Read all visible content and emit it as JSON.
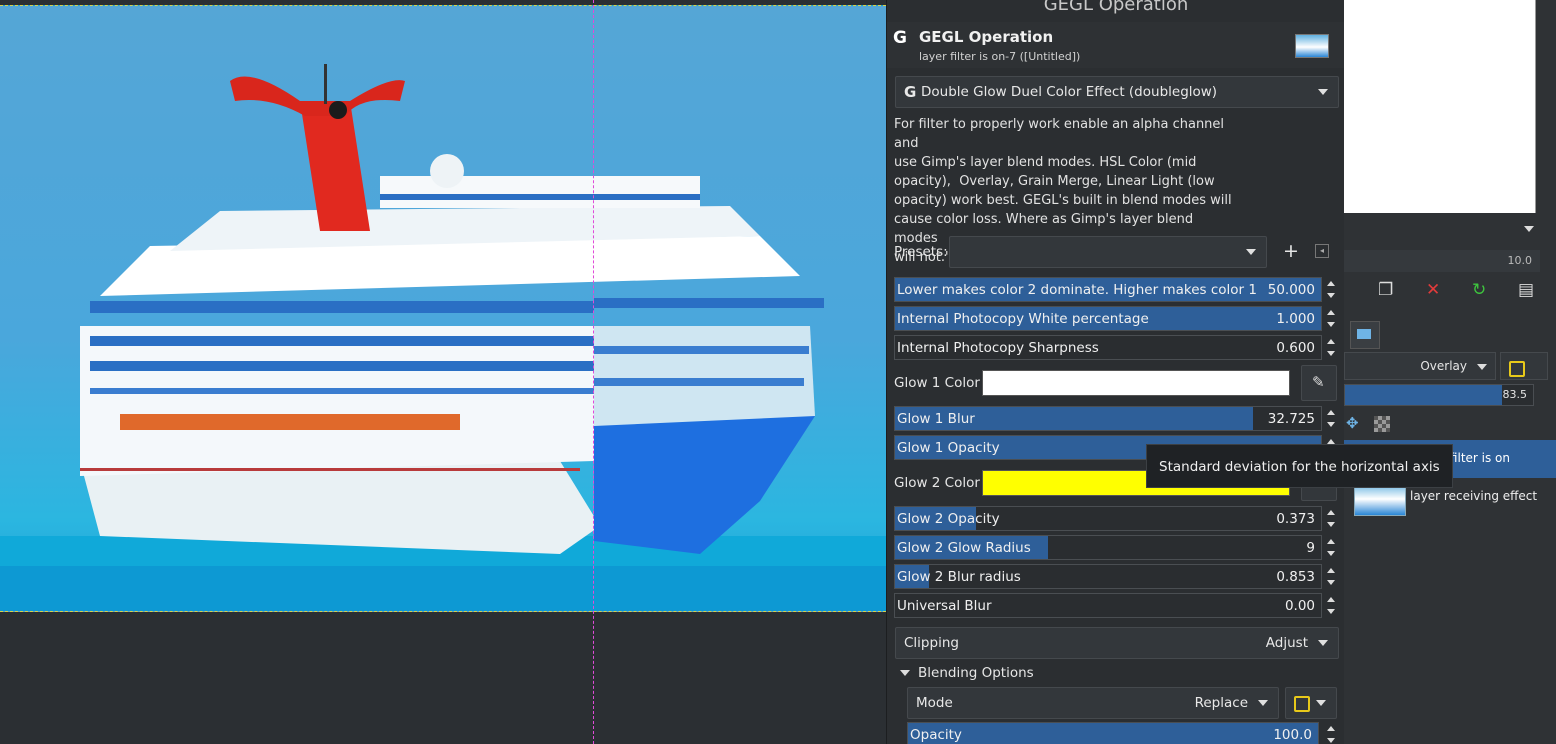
{
  "dialog": {
    "window_title": "GEGL Operation",
    "header_title": "GEGL Operation",
    "header_subtitle": "layer filter is on-7 ([Untitled])",
    "operation": "Double Glow Duel Color Effect (doubleglow)",
    "description": "For filter to properly work enable an alpha channel and\nuse Gimp's layer blend modes. HSL Color (mid\nopacity),  Overlay, Grain Merge, Linear Light (low\nopacity) work best. GEGL's built in blend modes will\ncause color loss. Where as Gimp's layer blend modes\nwill not.'",
    "presets_label": "Presets:",
    "presets_value": "",
    "sliders": [
      {
        "label": "Lower makes color 2 dominate. Higher makes color 1 domi...",
        "value": "50.000",
        "fraction": 1.0
      },
      {
        "label": "Internal Photocopy White percentage",
        "value": "1.000",
        "fraction": 1.0
      },
      {
        "label": "Internal Photocopy Sharpness",
        "value": "0.600",
        "fraction": 0.0
      },
      {
        "label": "Glow 1 Blur",
        "value": "32.725",
        "fraction": 0.84
      },
      {
        "label": "Glow 1 Opacity",
        "value": "",
        "fraction": 1.0
      },
      {
        "label": "Glow 2 Opacity",
        "value": "0.373",
        "fraction": 0.19
      },
      {
        "label": "Glow 2 Glow Radius",
        "value": "9",
        "fraction": 0.36
      },
      {
        "label": "Glow 2 Blur radius",
        "value": "0.853",
        "fraction": 0.08
      },
      {
        "label": "Universal Blur",
        "value": "0.00",
        "fraction": 0.0
      }
    ],
    "glow1_color": {
      "label": "Glow 1 Color",
      "color": "#ffffff"
    },
    "glow2_color": {
      "label": "Glow 2 Color",
      "color": "#ffff00"
    },
    "clipping_label": "Clipping",
    "clipping_value": "Adjust",
    "blending_options": "Blending Options",
    "mode_label": "Mode",
    "mode_value": "Replace",
    "opacity_label": "Opacity",
    "opacity_value": "100.0",
    "opacity_fraction": 1.0
  },
  "tooltip": "Standard deviation for the horizontal axis",
  "dock": {
    "spin_value": "10.0",
    "layer_mode": "Overlay",
    "layer_opacity": "83.5",
    "layer_opacity_fraction": 0.835,
    "layers": [
      {
        "name": "layer filter is on"
      },
      {
        "name": "layer receiving effect"
      }
    ]
  },
  "colors": {
    "accent": "#2e5f99",
    "panel": "#2b2e31",
    "guide": "#e04ad8",
    "selection_marching": "#d7d24a"
  },
  "icons": {
    "gegl": "gegl-logo-icon",
    "add_preset": "plus-icon",
    "picker": "eyedropper-icon"
  }
}
